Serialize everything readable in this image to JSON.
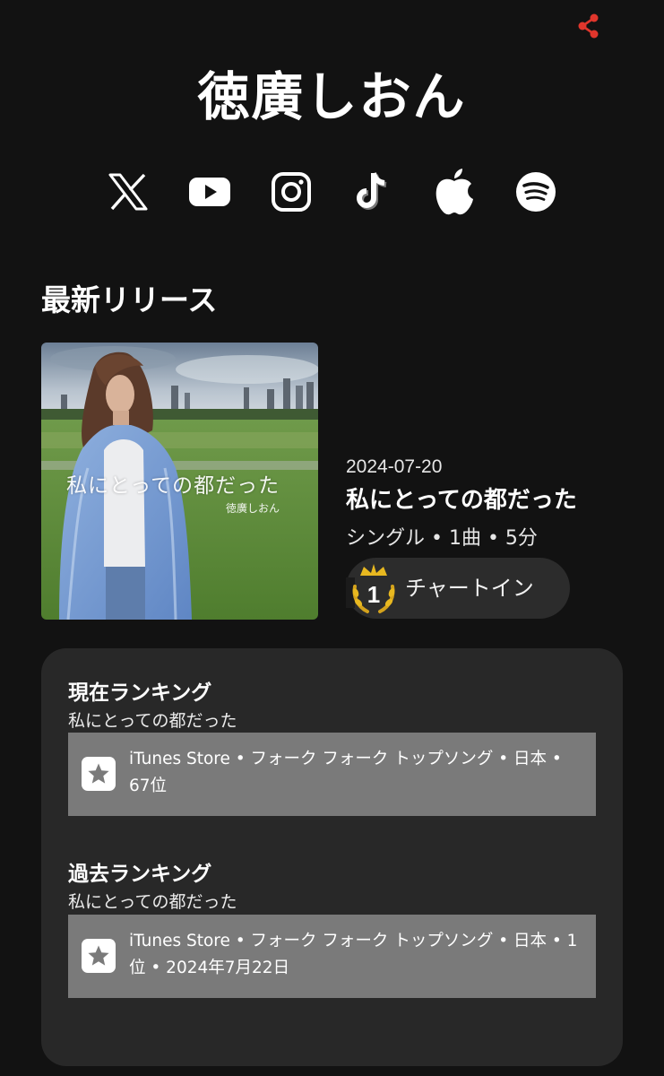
{
  "artist": {
    "name": "徳廣しおん"
  },
  "social_links": [
    {
      "icon": "x-icon"
    },
    {
      "icon": "youtube-icon"
    },
    {
      "icon": "instagram-icon"
    },
    {
      "icon": "tiktok-icon"
    },
    {
      "icon": "apple-icon"
    },
    {
      "icon": "spotify-icon"
    }
  ],
  "latest_release": {
    "section_title": "最新リリース",
    "cover_text": "私にとっての都だった",
    "cover_artist": "徳廣しおん",
    "date": "2024-07-20",
    "title": "私にとっての都だった",
    "meta": "シングル • 1曲 • 5分",
    "chart_badge_number": "1",
    "chart_label": "チャートイン"
  },
  "current_ranking": {
    "heading": "現在ランキング",
    "song": "私にとっての都だった",
    "entry": "iTunes Store • フォーク フォーク トップソング • 日本 • 67位"
  },
  "past_ranking": {
    "heading": "過去ランキング",
    "song": "私にとっての都だった",
    "entry": "iTunes Store • フォーク フォーク トップソング • 日本 • 1位 • 2024年7月22日"
  },
  "colors": {
    "background": "#121212",
    "card": "#282828",
    "ranking_box": "#7a7a7a",
    "share_accent": "#e0362c",
    "badge_gold": "#e8b820"
  }
}
